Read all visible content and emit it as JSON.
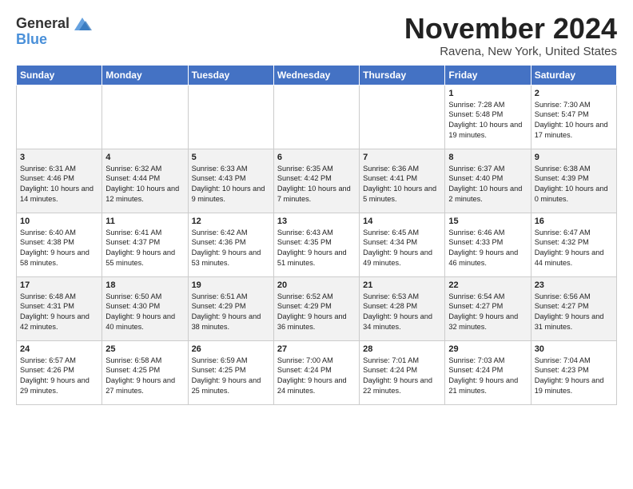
{
  "logo": {
    "text_general": "General",
    "text_blue": "Blue"
  },
  "title": "November 2024",
  "location": "Ravena, New York, United States",
  "headers": [
    "Sunday",
    "Monday",
    "Tuesday",
    "Wednesday",
    "Thursday",
    "Friday",
    "Saturday"
  ],
  "weeks": [
    [
      {
        "day": "",
        "info": ""
      },
      {
        "day": "",
        "info": ""
      },
      {
        "day": "",
        "info": ""
      },
      {
        "day": "",
        "info": ""
      },
      {
        "day": "",
        "info": ""
      },
      {
        "day": "1",
        "info": "Sunrise: 7:28 AM\nSunset: 5:48 PM\nDaylight: 10 hours and 19 minutes."
      },
      {
        "day": "2",
        "info": "Sunrise: 7:30 AM\nSunset: 5:47 PM\nDaylight: 10 hours and 17 minutes."
      }
    ],
    [
      {
        "day": "3",
        "info": "Sunrise: 6:31 AM\nSunset: 4:46 PM\nDaylight: 10 hours and 14 minutes."
      },
      {
        "day": "4",
        "info": "Sunrise: 6:32 AM\nSunset: 4:44 PM\nDaylight: 10 hours and 12 minutes."
      },
      {
        "day": "5",
        "info": "Sunrise: 6:33 AM\nSunset: 4:43 PM\nDaylight: 10 hours and 9 minutes."
      },
      {
        "day": "6",
        "info": "Sunrise: 6:35 AM\nSunset: 4:42 PM\nDaylight: 10 hours and 7 minutes."
      },
      {
        "day": "7",
        "info": "Sunrise: 6:36 AM\nSunset: 4:41 PM\nDaylight: 10 hours and 5 minutes."
      },
      {
        "day": "8",
        "info": "Sunrise: 6:37 AM\nSunset: 4:40 PM\nDaylight: 10 hours and 2 minutes."
      },
      {
        "day": "9",
        "info": "Sunrise: 6:38 AM\nSunset: 4:39 PM\nDaylight: 10 hours and 0 minutes."
      }
    ],
    [
      {
        "day": "10",
        "info": "Sunrise: 6:40 AM\nSunset: 4:38 PM\nDaylight: 9 hours and 58 minutes."
      },
      {
        "day": "11",
        "info": "Sunrise: 6:41 AM\nSunset: 4:37 PM\nDaylight: 9 hours and 55 minutes."
      },
      {
        "day": "12",
        "info": "Sunrise: 6:42 AM\nSunset: 4:36 PM\nDaylight: 9 hours and 53 minutes."
      },
      {
        "day": "13",
        "info": "Sunrise: 6:43 AM\nSunset: 4:35 PM\nDaylight: 9 hours and 51 minutes."
      },
      {
        "day": "14",
        "info": "Sunrise: 6:45 AM\nSunset: 4:34 PM\nDaylight: 9 hours and 49 minutes."
      },
      {
        "day": "15",
        "info": "Sunrise: 6:46 AM\nSunset: 4:33 PM\nDaylight: 9 hours and 46 minutes."
      },
      {
        "day": "16",
        "info": "Sunrise: 6:47 AM\nSunset: 4:32 PM\nDaylight: 9 hours and 44 minutes."
      }
    ],
    [
      {
        "day": "17",
        "info": "Sunrise: 6:48 AM\nSunset: 4:31 PM\nDaylight: 9 hours and 42 minutes."
      },
      {
        "day": "18",
        "info": "Sunrise: 6:50 AM\nSunset: 4:30 PM\nDaylight: 9 hours and 40 minutes."
      },
      {
        "day": "19",
        "info": "Sunrise: 6:51 AM\nSunset: 4:29 PM\nDaylight: 9 hours and 38 minutes."
      },
      {
        "day": "20",
        "info": "Sunrise: 6:52 AM\nSunset: 4:29 PM\nDaylight: 9 hours and 36 minutes."
      },
      {
        "day": "21",
        "info": "Sunrise: 6:53 AM\nSunset: 4:28 PM\nDaylight: 9 hours and 34 minutes."
      },
      {
        "day": "22",
        "info": "Sunrise: 6:54 AM\nSunset: 4:27 PM\nDaylight: 9 hours and 32 minutes."
      },
      {
        "day": "23",
        "info": "Sunrise: 6:56 AM\nSunset: 4:27 PM\nDaylight: 9 hours and 31 minutes."
      }
    ],
    [
      {
        "day": "24",
        "info": "Sunrise: 6:57 AM\nSunset: 4:26 PM\nDaylight: 9 hours and 29 minutes."
      },
      {
        "day": "25",
        "info": "Sunrise: 6:58 AM\nSunset: 4:25 PM\nDaylight: 9 hours and 27 minutes."
      },
      {
        "day": "26",
        "info": "Sunrise: 6:59 AM\nSunset: 4:25 PM\nDaylight: 9 hours and 25 minutes."
      },
      {
        "day": "27",
        "info": "Sunrise: 7:00 AM\nSunset: 4:24 PM\nDaylight: 9 hours and 24 minutes."
      },
      {
        "day": "28",
        "info": "Sunrise: 7:01 AM\nSunset: 4:24 PM\nDaylight: 9 hours and 22 minutes."
      },
      {
        "day": "29",
        "info": "Sunrise: 7:03 AM\nSunset: 4:24 PM\nDaylight: 9 hours and 21 minutes."
      },
      {
        "day": "30",
        "info": "Sunrise: 7:04 AM\nSunset: 4:23 PM\nDaylight: 9 hours and 19 minutes."
      }
    ]
  ]
}
